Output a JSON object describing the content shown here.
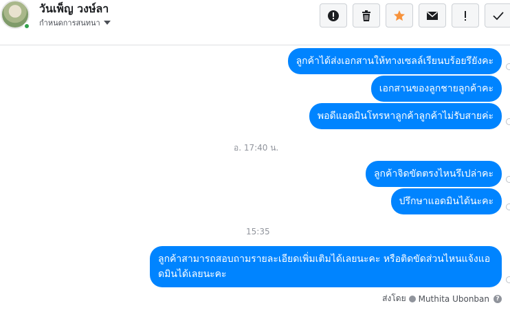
{
  "header": {
    "contact_name": "วันเพ็ญ วงษ์ลา",
    "manage_label": "กำหนดการสนทนา"
  },
  "actions": [
    {
      "name": "report",
      "icon": "exclamation-circle-icon"
    },
    {
      "name": "delete",
      "icon": "trash-icon"
    },
    {
      "name": "star",
      "icon": "star-icon",
      "color": "#f7923b"
    },
    {
      "name": "mark-unread",
      "icon": "envelope-icon"
    },
    {
      "name": "spam",
      "icon": "exclamation-icon"
    },
    {
      "name": "done",
      "icon": "check-icon"
    }
  ],
  "messages": {
    "m1": "ลูกค้าได้ส่งเอกสานให้ทางเซลล์เรียนบร้อยรึยังคะ",
    "m2": "เอกสานของลูกชายลูกค้าคะ",
    "m3": "พอดีแอดมินโทรหาลูกค้าลูกค้าไม่รับสายค่ะ",
    "m4": "ลูกค้าจิดขัดตรงไหนรึเปล่าคะ",
    "m5": "ปรึกษาแอดมินได้นะคะ",
    "m6": "ลูกค้าสามารถสอบถามรายละเอียดเพิ่มเติมได้เลยนะคะ หรือติดขัดส่วนไหนแจ้งแอดมินได้เลยนะคะ"
  },
  "timestamps": {
    "t1": "อ. 17:40 น.",
    "t2": "15:35"
  },
  "footer": {
    "sent_by_label": "ส่งโดย",
    "sender_name": "Muthita Ubonban"
  },
  "colors": {
    "bubble": "#0084ff",
    "accent_star": "#f7923b"
  }
}
